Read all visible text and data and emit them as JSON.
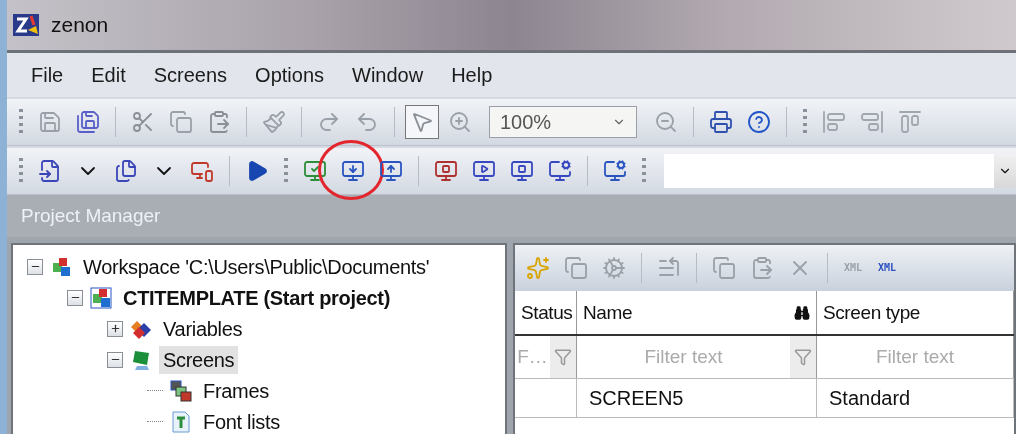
{
  "window": {
    "title": "zenon"
  },
  "menu": [
    {
      "label": "File"
    },
    {
      "label": "Edit"
    },
    {
      "label": "Screens"
    },
    {
      "label": "Options"
    },
    {
      "label": "Window"
    },
    {
      "label": "Help"
    }
  ],
  "toolbar": {
    "zoom": "100%"
  },
  "panel": {
    "title": "Project Manager"
  },
  "tree": [
    {
      "kind": "workspace",
      "label": "Workspace 'C:\\Users\\Public\\Documents'",
      "expanded": true,
      "selected": false,
      "children": [
        {
          "kind": "project",
          "label": "CTITEMPLATE (Start project)",
          "expanded": true,
          "selected": false,
          "children": [
            {
              "kind": "variables",
              "label": "Variables",
              "expanded": false,
              "selected": false
            },
            {
              "kind": "screens",
              "label": "Screens",
              "expanded": true,
              "selected": true,
              "children": [
                {
                  "kind": "frames",
                  "label": "Frames",
                  "selected": false
                },
                {
                  "kind": "fonts",
                  "label": "Font lists",
                  "selected": false
                }
              ]
            }
          ]
        }
      ]
    }
  ],
  "table": {
    "toolbar_labels": [
      "XML",
      "XML"
    ],
    "columns": [
      {
        "label": "Status",
        "search": false,
        "filter_placeholder": "F…",
        "filter_button": true
      },
      {
        "label": "Name",
        "search": true,
        "filter_placeholder": "Filter text",
        "filter_button": true
      },
      {
        "label": "Screen type",
        "search": false,
        "filter_placeholder": "Filter text",
        "filter_button": false
      }
    ],
    "rows": [
      {
        "name": "SCREEN5",
        "screen_type": "Standard"
      }
    ]
  }
}
